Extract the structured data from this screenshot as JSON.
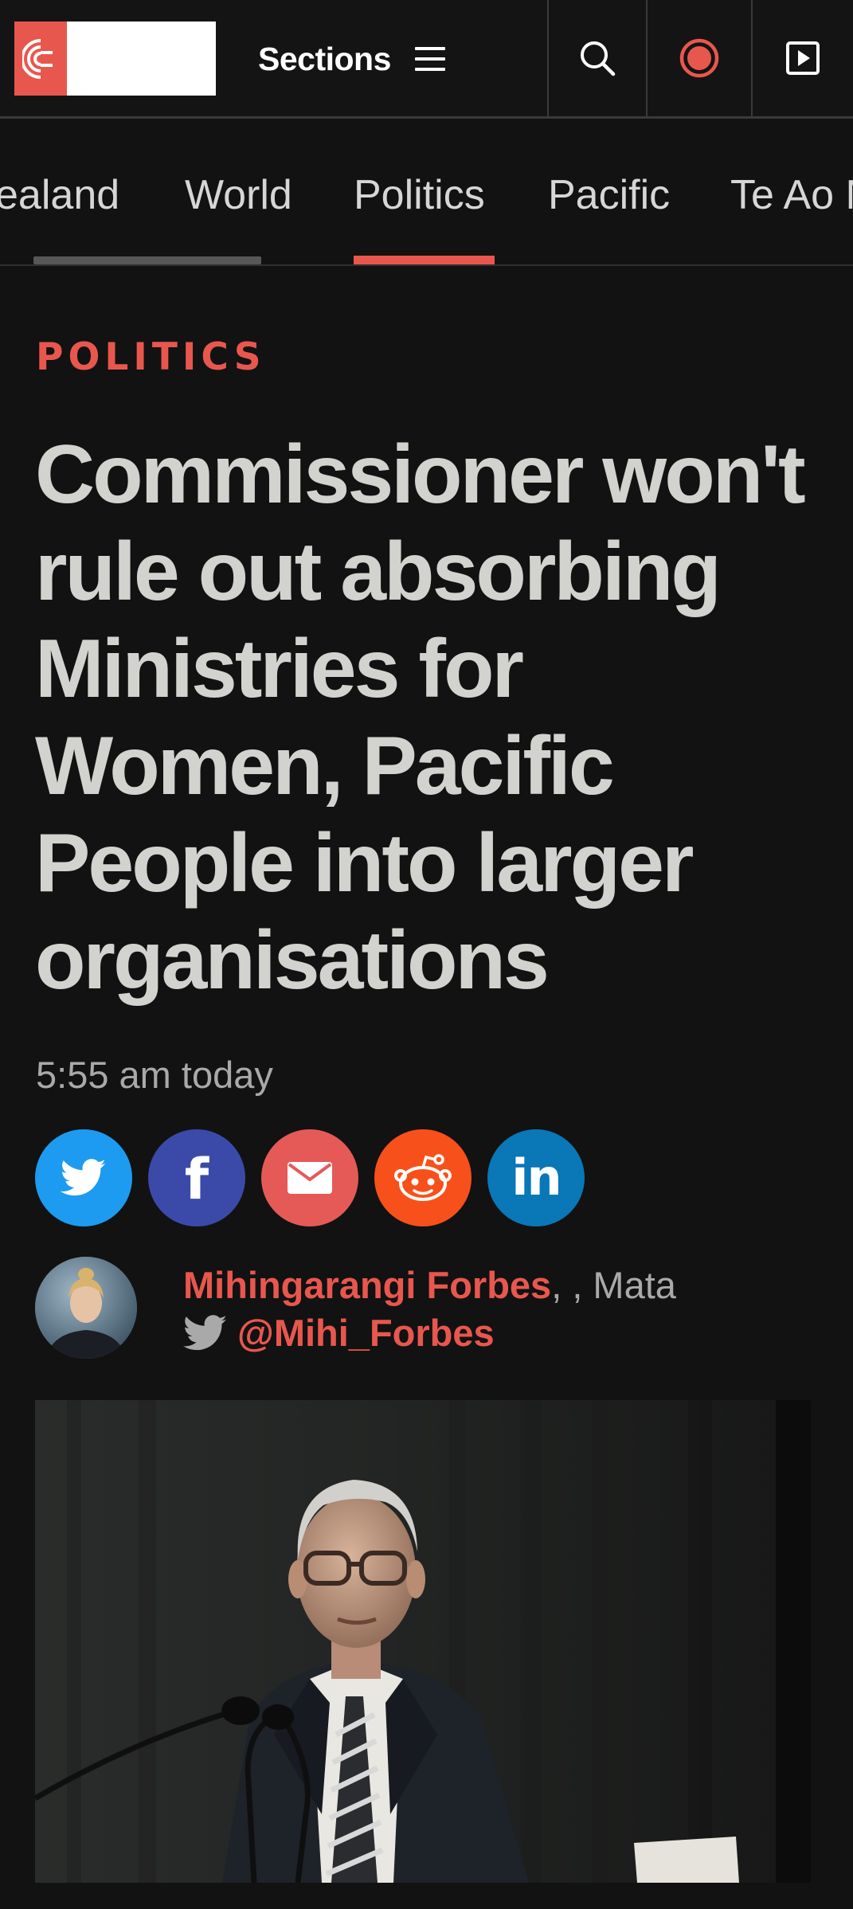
{
  "header": {
    "sections_label": "Sections"
  },
  "nav": {
    "tabs": [
      "ealand",
      "World",
      "Politics",
      "Pacific",
      "Te Ao M"
    ],
    "active": "Politics"
  },
  "article": {
    "kicker": "POLITICS",
    "headline": "Commissioner won't rule out absorbing Ministries for Women, Pacific People into larger organisations",
    "timestamp": "5:55 am today",
    "author": {
      "name": "Mihingarangi Forbes",
      "suffix": ", , Mata",
      "twitter_handle": "@Mihi_Forbes"
    }
  },
  "share": {
    "buttons": [
      "twitter",
      "facebook",
      "email",
      "reddit",
      "linkedin"
    ]
  },
  "icons": {
    "search": "search-icon",
    "live": "live-radio-icon",
    "play": "play-video-icon",
    "menu": "menu-icon"
  },
  "colors": {
    "accent": "#e8574e",
    "background": "#121212",
    "headline": "#d2d3ce",
    "twitter": "#1d9bf0",
    "facebook": "#3b4aa9",
    "email": "#e55a57",
    "reddit": "#f8501a",
    "linkedin": "#0a77b7"
  }
}
